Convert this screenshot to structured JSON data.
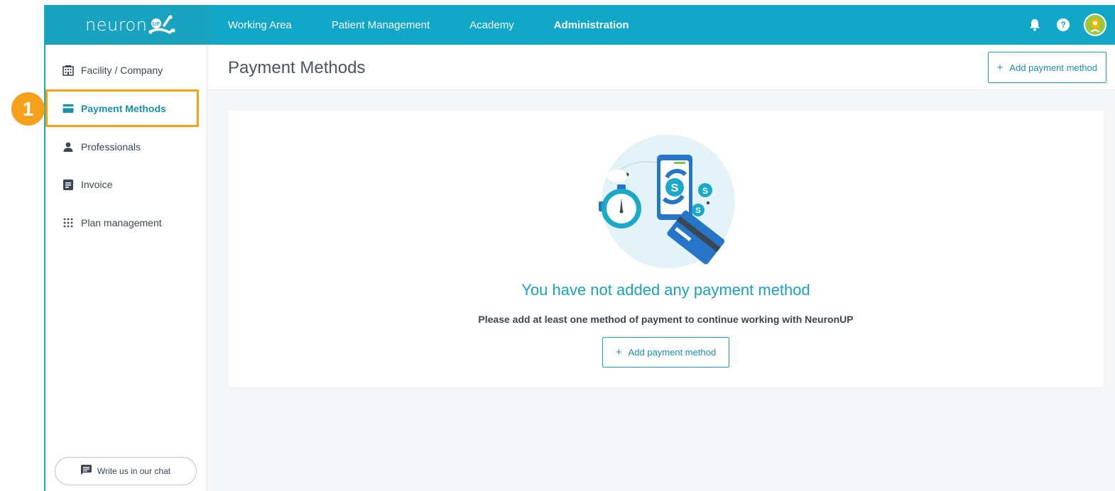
{
  "app": {
    "logo_text": "neuron",
    "logo_badge": "UP"
  },
  "nav": {
    "items": [
      {
        "label": "Working Area"
      },
      {
        "label": "Patient Management"
      },
      {
        "label": "Academy"
      },
      {
        "label": "Administration"
      }
    ],
    "active": "Administration",
    "help_label": "?"
  },
  "sidebar": {
    "items": [
      {
        "label": "Facility / Company",
        "icon": "building-icon"
      },
      {
        "label": "Payment Methods",
        "icon": "credit-card-icon"
      },
      {
        "label": "Professionals",
        "icon": "person-icon"
      },
      {
        "label": "Invoice",
        "icon": "document-icon"
      },
      {
        "label": "Plan management",
        "icon": "grid-dots-icon"
      }
    ],
    "active": "Payment Methods",
    "chat_label": "Write us in our chat"
  },
  "header": {
    "title": "Payment Methods",
    "add_button": "Add payment method",
    "plus": "+"
  },
  "empty_state": {
    "title": "You have not added any payment method",
    "subtitle": "Please add at least one method of payment to continue working with NeuronUP",
    "add_button": "Add payment method",
    "plus": "+",
    "coin_symbol": "S"
  },
  "callout": {
    "number": "1",
    "color": "#f7a01b"
  },
  "colors": {
    "brand": "#12a7c6",
    "accent_text": "#1891ad",
    "callout": "#f7a01b"
  }
}
